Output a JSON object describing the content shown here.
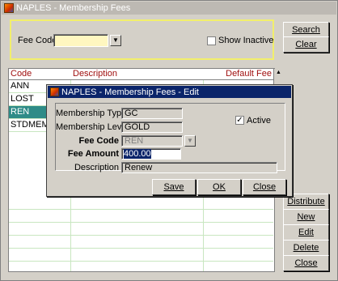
{
  "window": {
    "title": "NAPLES - Membership Fees"
  },
  "filter": {
    "fee_code_label": "Fee Code",
    "fee_code_value": "",
    "show_inactive_label": "Show Inactive",
    "show_inactive_checked": false
  },
  "right_buttons": {
    "search": "Search",
    "clear": "Clear",
    "distribute": "Distribute",
    "new": "New",
    "edit": "Edit",
    "delete": "Delete",
    "close": "Close"
  },
  "grid": {
    "headers": {
      "code": "Code",
      "description": "Description",
      "default_fee": "Default Fee"
    },
    "rows": [
      {
        "code": "ANN",
        "description": "",
        "fee": "",
        "selected": false
      },
      {
        "code": "LOST",
        "description": "",
        "fee": "",
        "selected": false
      },
      {
        "code": "REN",
        "description": "",
        "fee": "",
        "selected": true
      },
      {
        "code": "STDMEM",
        "description": "",
        "fee": "",
        "selected": false
      }
    ]
  },
  "dialog": {
    "title": "NAPLES - Membership Fees - Edit",
    "membership_type_label": "Membership Type",
    "membership_type_value": "GC",
    "membership_level_label": "Membership Level",
    "membership_level_value": "GOLD",
    "fee_code_label": "Fee Code",
    "fee_code_value": "REN",
    "fee_amount_label": "Fee Amount",
    "fee_amount_value": "400.00",
    "description_label": "Description",
    "description_value": "Renew",
    "active_label": "Active",
    "active_checked": true,
    "save": "Save",
    "ok": "OK",
    "close": "Close"
  },
  "colors": {
    "selected_row": "#2e8b87",
    "header_text": "#a01010",
    "filter_border": "#f2ef6c",
    "dialog_title": "#0a246a"
  }
}
